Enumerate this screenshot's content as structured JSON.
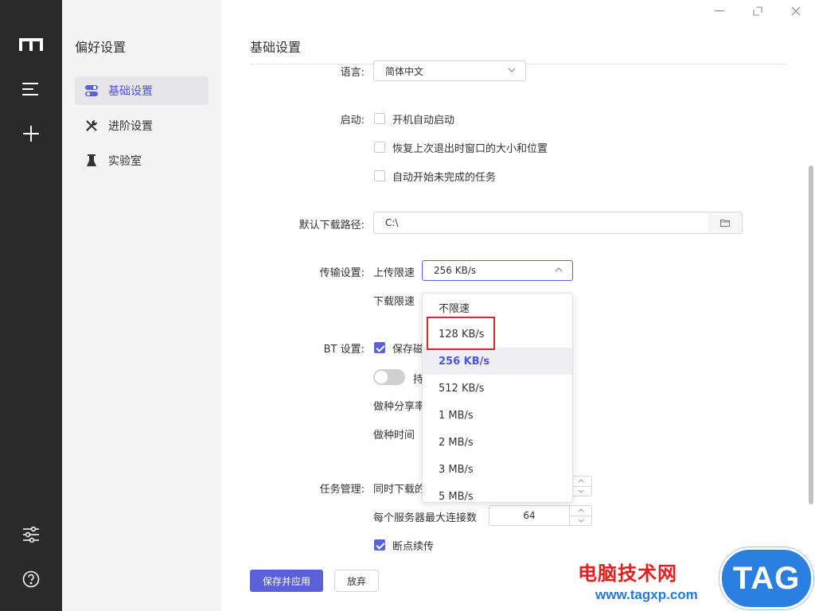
{
  "sidebar": {
    "title": "偏好设置",
    "items": [
      {
        "label": "基础设置",
        "icon": "toggle-icon",
        "active": true
      },
      {
        "label": "进阶设置",
        "icon": "wrench-icon",
        "active": false
      },
      {
        "label": "实验室",
        "icon": "flask-icon",
        "active": false
      }
    ]
  },
  "rail": {
    "icons": [
      "app-logo-icon",
      "menu-icon",
      "plus-icon",
      "sliders-icon",
      "help-icon"
    ]
  },
  "main": {
    "title": "基础设置",
    "language": {
      "label": "语言:",
      "value": "简体中文"
    },
    "startup": {
      "label": "启动:",
      "options": [
        {
          "label": "开机自动启动",
          "checked": false
        },
        {
          "label": "恢复上次退出时窗口的大小和位置",
          "checked": false
        },
        {
          "label": "自动开始未完成的任务",
          "checked": false
        }
      ]
    },
    "download_path": {
      "label": "默认下载路径:",
      "value": "C:\\"
    },
    "transfer": {
      "label": "传输设置:",
      "upload_label": "上传限速",
      "upload_value": "256 KB/s",
      "download_label": "下载限速"
    },
    "bt": {
      "label": "BT 设置:",
      "save_magnet_label": "保存磁",
      "save_magnet_checked": true,
      "toggle_label": "持",
      "seed_ratio_label": "做种分享率",
      "seed_time_label": "做种时间"
    },
    "task": {
      "label": "任务管理:",
      "concurrent_label": "同时下载的",
      "max_conn_label": "每个服务器最大连接数",
      "max_conn_value": "64",
      "resume_label": "断点续传",
      "resume_checked": true
    },
    "buttons": {
      "save": "保存并应用",
      "discard": "放弃"
    }
  },
  "dropdown": {
    "options": [
      "不限速",
      "128 KB/s",
      "256 KB/s",
      "512 KB/s",
      "1 MB/s",
      "2 MB/s",
      "3 MB/s",
      "5 MB/s"
    ],
    "selected": "256 KB/s",
    "highlighted": "128 KB/s"
  },
  "watermark": {
    "site_name": "电脑技术网",
    "url": "www.tagxp.com",
    "logo_text": "TAG"
  },
  "colors": {
    "accent": "#5b62d9",
    "rail": "#2a2a2a",
    "sidebar": "#f4f4f5",
    "highlight": "#d62b2b"
  }
}
